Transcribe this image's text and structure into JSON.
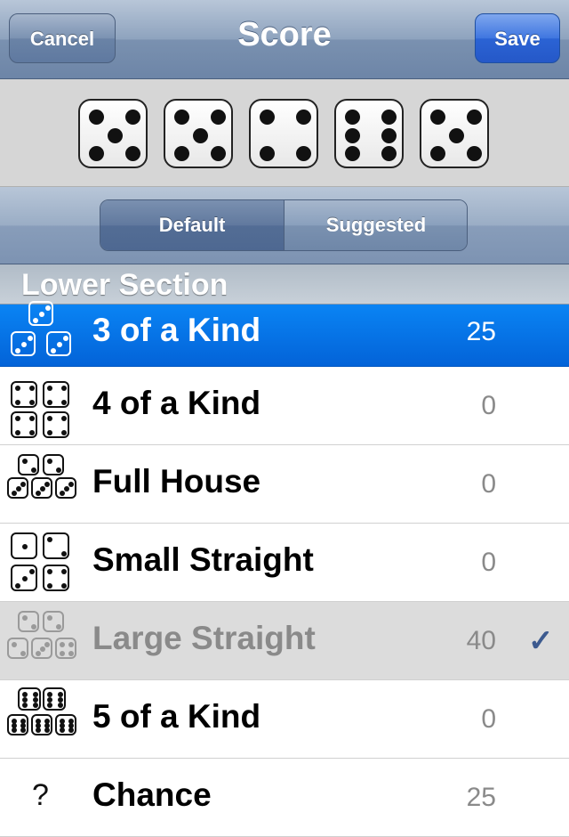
{
  "navbar": {
    "title": "Score",
    "cancel_label": "Cancel",
    "save_label": "Save"
  },
  "dice": [
    5,
    5,
    4,
    6,
    5
  ],
  "segments": {
    "default_label": "Default",
    "suggested_label": "Suggested",
    "selected": "Default"
  },
  "section": {
    "title": "Lower Section"
  },
  "rows": [
    {
      "label": "3 of a Kind",
      "value": "25",
      "state": "selected",
      "icon": "three-of-a-kind-icon"
    },
    {
      "label": "4 of a Kind",
      "value": "0",
      "state": "normal",
      "icon": "four-of-a-kind-icon"
    },
    {
      "label": "Full House",
      "value": "0",
      "state": "normal",
      "icon": "full-house-icon"
    },
    {
      "label": "Small Straight",
      "value": "0",
      "state": "normal",
      "icon": "small-straight-icon"
    },
    {
      "label": "Large Straight",
      "value": "40",
      "state": "disabled",
      "icon": "large-straight-icon",
      "checked": true,
      "check_glyph": "✓"
    },
    {
      "label": "5 of a Kind",
      "value": "0",
      "state": "normal",
      "icon": "five-of-a-kind-icon"
    },
    {
      "label": "Chance",
      "value": "25",
      "state": "normal",
      "icon": "chance-icon",
      "glyph": "?"
    }
  ],
  "colors": {
    "selected_row": "#0a84f4",
    "save_button": "#2b63d4",
    "navbar": "#7a91b0"
  }
}
